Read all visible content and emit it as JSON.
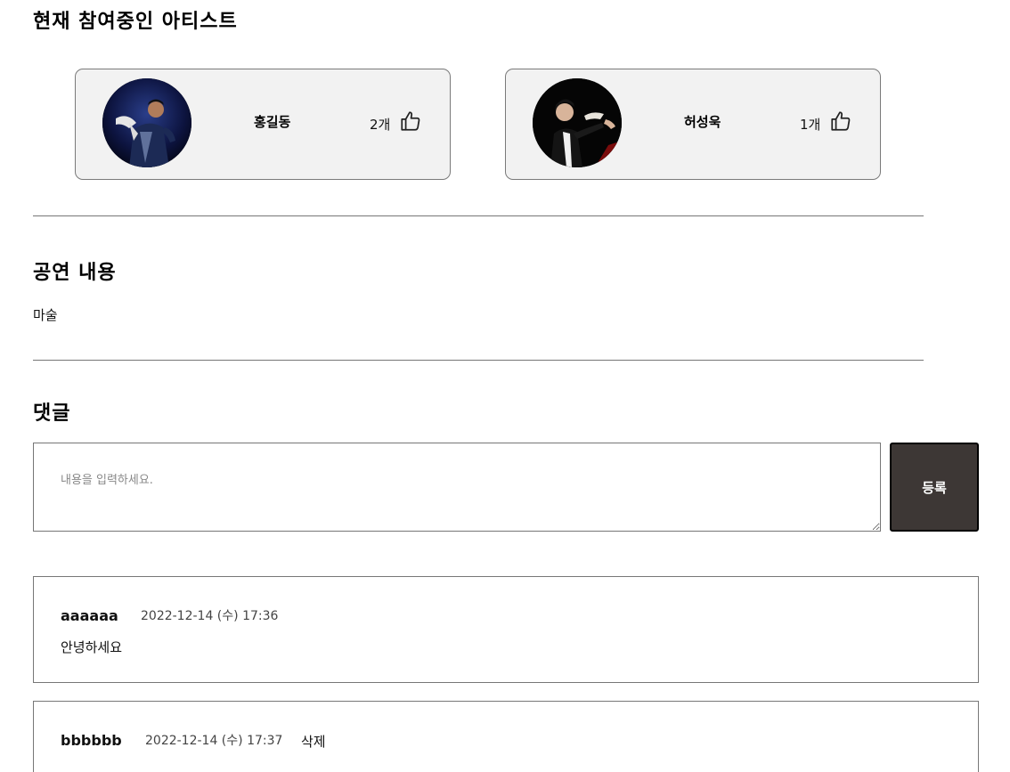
{
  "sections": {
    "artists_title": "현재 참여중인 아티스트",
    "content_title": "공연 내용",
    "comments_title": "댓글"
  },
  "artists": [
    {
      "name": "홍길동",
      "likes": "2개"
    },
    {
      "name": "허성욱",
      "likes": "1개"
    }
  ],
  "icons": {
    "like": "thumbs-up-icon"
  },
  "content": {
    "text": "마술"
  },
  "comment_form": {
    "placeholder": "내용을 입력하세요.",
    "submit_label": "등록"
  },
  "comments": [
    {
      "author": "aaaaaa",
      "date": "2022-12-14 (수) 17:36",
      "body": "안녕하세요"
    },
    {
      "author": "bbbbbb",
      "date": "2022-12-14 (수) 17:37",
      "delete_label": "삭제",
      "body": "...."
    }
  ],
  "colors": {
    "submit_bg": "#3d3735",
    "card_bg": "#f2f2f2"
  }
}
